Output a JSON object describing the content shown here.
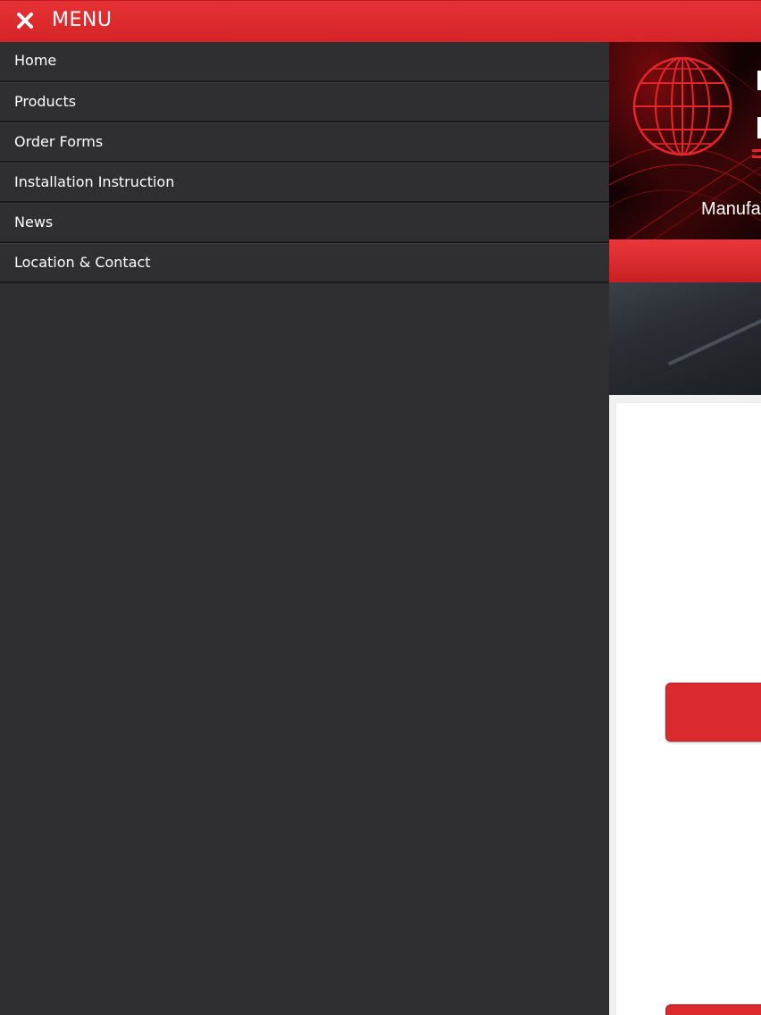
{
  "header": {
    "close_icon": "close-icon",
    "title": "MENU",
    "bar_color": "#e02a2e"
  },
  "drawer": {
    "background": "#2f2e30",
    "items": [
      {
        "label": "Home"
      },
      {
        "label": "Products"
      },
      {
        "label": "Order Forms"
      },
      {
        "label": "Installation Instruction"
      },
      {
        "label": "News"
      },
      {
        "label": "Location & Contact"
      }
    ]
  },
  "page": {
    "hero": {
      "logo_icon": "globe-icon",
      "tagline": "Manufa"
    },
    "accent": "#da2a2e"
  }
}
